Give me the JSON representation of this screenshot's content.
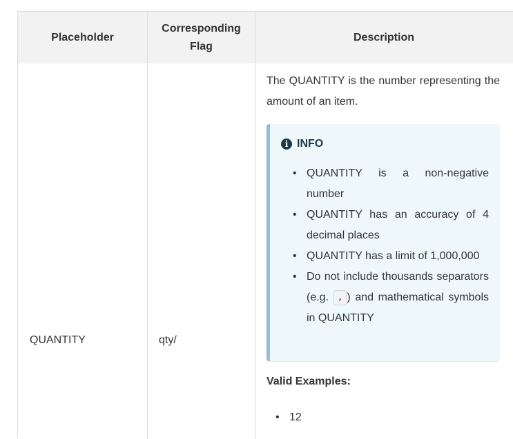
{
  "table": {
    "headers": {
      "placeholder": "Placeholder",
      "flag_line1": "Corresponding",
      "flag_line2": "Flag",
      "description": "Description"
    },
    "row": {
      "placeholder": "QUANTITY",
      "flag": "qty/",
      "description_intro": "The QUANTITY is the number representing the amount of an item.",
      "info": {
        "icon": "info-icon",
        "title": "INFO",
        "items": [
          "QUANTITY is a non-negative number",
          "QUANTITY has an accuracy of 4 decimal places",
          "QUANTITY has a limit of 1,000,000"
        ],
        "last_item_before": "Do not include thousands separators (e.g.",
        "last_item_code": ",",
        "last_item_after": ") and mathematical symbols in QUANTITY"
      },
      "valid_examples_title": "Valid Examples:",
      "valid_examples": [
        "12"
      ]
    }
  },
  "colors": {
    "header_bg": "#f2f2f2",
    "border": "#dddddd",
    "info_bg": "#eef8fb",
    "info_accent": "#93bdd6",
    "text": "#333333"
  }
}
